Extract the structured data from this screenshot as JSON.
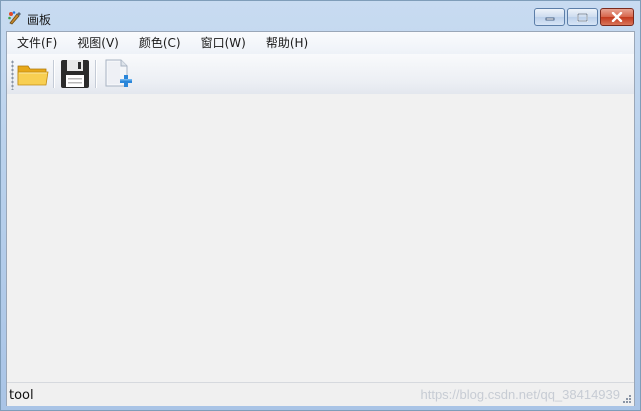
{
  "window": {
    "title": "画板",
    "title_icon": "paint-app-icon",
    "controls": {
      "minimize": "minimize-icon",
      "maximize": "maximize-icon",
      "close": "close-icon"
    }
  },
  "menu": {
    "items": [
      {
        "label": "文件(F)"
      },
      {
        "label": "视图(V)"
      },
      {
        "label": "颜色(C)"
      },
      {
        "label": "窗口(W)"
      },
      {
        "label": "帮助(H)"
      }
    ]
  },
  "toolbar": {
    "buttons": [
      {
        "icon": "open-folder-icon"
      },
      {
        "icon": "save-floppy-icon"
      },
      {
        "icon": "new-file-icon"
      }
    ]
  },
  "statusbar": {
    "label": "tool",
    "watermark": "https://blog.csdn.net/qq_38414939"
  },
  "colors": {
    "titlebar": "#b9d1ec",
    "client_bg": "#f1f1f1",
    "close_button": "#c3391e"
  }
}
